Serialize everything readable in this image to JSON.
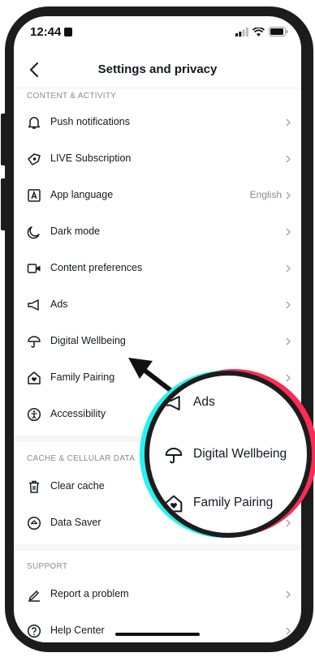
{
  "status_bar": {
    "time": "12:44"
  },
  "header": {
    "title": "Settings and privacy"
  },
  "sections": [
    {
      "title": "CONTENT & ACTIVITY",
      "items": [
        {
          "icon": "bell-icon",
          "label": "Push notifications",
          "value": ""
        },
        {
          "icon": "live-subscription-icon",
          "label": "LIVE Subscription",
          "value": ""
        },
        {
          "icon": "language-icon",
          "label": "App language",
          "value": "English"
        },
        {
          "icon": "moon-icon",
          "label": "Dark mode",
          "value": ""
        },
        {
          "icon": "video-camera-icon",
          "label": "Content preferences",
          "value": ""
        },
        {
          "icon": "megaphone-icon",
          "label": "Ads",
          "value": ""
        },
        {
          "icon": "umbrella-icon",
          "label": "Digital Wellbeing",
          "value": ""
        },
        {
          "icon": "home-heart-icon",
          "label": "Family Pairing",
          "value": ""
        },
        {
          "icon": "accessibility-icon",
          "label": "Accessibility",
          "value": ""
        }
      ]
    },
    {
      "title": "CACHE & CELLULAR DATA",
      "items": [
        {
          "icon": "trash-icon",
          "label": "Clear cache",
          "value": ""
        },
        {
          "icon": "data-saver-icon",
          "label": "Data Saver",
          "value": ""
        }
      ]
    },
    {
      "title": "SUPPORT",
      "items": [
        {
          "icon": "pencil-icon",
          "label": "Report a problem",
          "value": ""
        },
        {
          "icon": "help-icon",
          "label": "Help Center",
          "value": ""
        }
      ]
    }
  ],
  "magnifier": {
    "items": [
      {
        "icon": "megaphone-icon",
        "label": "Ads"
      },
      {
        "icon": "umbrella-icon",
        "label": "Digital Wellbeing"
      },
      {
        "icon": "home-heart-icon",
        "label": "Family Pairing"
      }
    ]
  },
  "colors": {
    "text": "#161823",
    "secondary": "#8a8b91",
    "cyan": "#25f4ee",
    "pink": "#fe2c55",
    "frame": "#1c1c1c"
  }
}
